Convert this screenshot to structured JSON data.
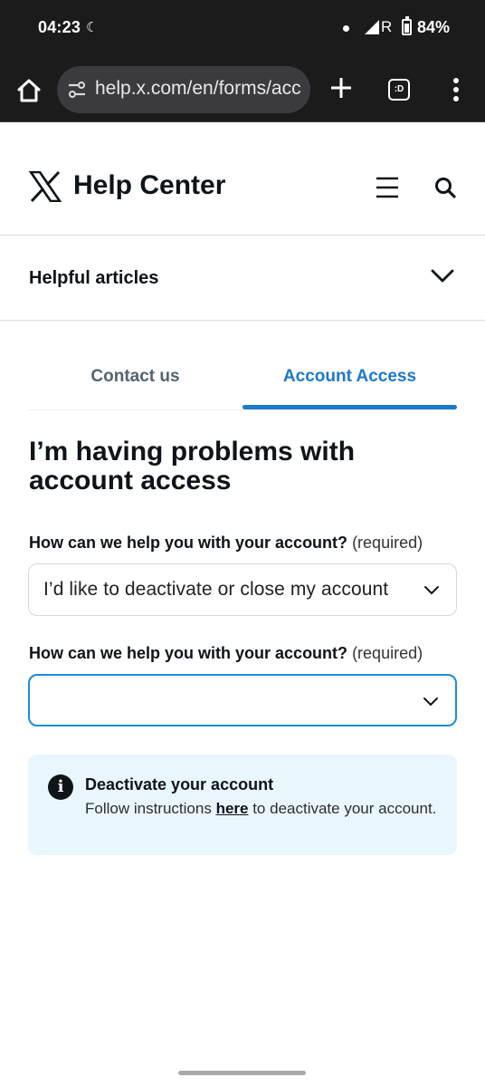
{
  "status_bar": {
    "time": "04:23",
    "moon_icon": "☾",
    "network": "R",
    "battery": "84%"
  },
  "browser": {
    "url": "help.x.com/en/forms/acc",
    "tabs_label": ":D"
  },
  "header": {
    "title": "Help Center"
  },
  "helpful_articles": {
    "label": "Helpful articles"
  },
  "tabs": [
    {
      "label": "Contact us",
      "active": false
    },
    {
      "label": "Account Access",
      "active": true
    }
  ],
  "page": {
    "heading": "I’m having problems with account access"
  },
  "form": {
    "field1": {
      "label": "How can we help you with your account?",
      "required": "(required)",
      "value": "I’d like to deactivate or close my account"
    },
    "field2": {
      "label": "How can we help you with your account?",
      "required": "(required)",
      "value": ""
    }
  },
  "info": {
    "icon": "i",
    "title": "Deactivate your account",
    "text_before": "Follow instructions ",
    "link": "here",
    "text_after": " to deactivate your account."
  },
  "colors": {
    "accent": "#1d7ac8",
    "focus_border": "#1d8ae0",
    "info_bg": "#e9f6fd"
  }
}
